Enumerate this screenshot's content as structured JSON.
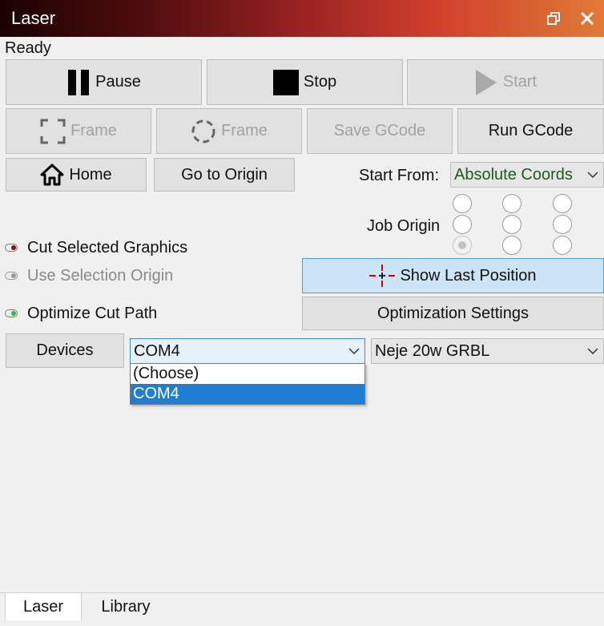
{
  "window": {
    "title": "Laser"
  },
  "status": "Ready",
  "controls": {
    "pause": "Pause",
    "stop": "Stop",
    "start": "Start",
    "frame_rect": "Frame",
    "frame_circle": "Frame",
    "save_gcode": "Save GCode",
    "run_gcode": "Run GCode",
    "home": "Home",
    "go_to_origin": "Go to Origin"
  },
  "start_from": {
    "label": "Start From:",
    "value": "Absolute Coords"
  },
  "job_origin": {
    "label": "Job Origin",
    "selected_index": 6
  },
  "options": {
    "cut_selected": {
      "label": "Cut Selected Graphics",
      "enabled": true
    },
    "use_selection_origin": {
      "label": "Use Selection Origin",
      "enabled": false
    },
    "optimize_cut_path": {
      "label": "Optimize Cut Path",
      "enabled": true
    }
  },
  "show_last_position": "Show Last Position",
  "optimization_settings": "Optimization Settings",
  "devices": {
    "button": "Devices",
    "port": "COM4",
    "port_options": [
      "(Choose)",
      "COM4"
    ],
    "profile": "Neje 20w GRBL"
  },
  "tabs": [
    "Laser",
    "Library"
  ],
  "colors": {
    "title_start": "#1b0202",
    "title_end": "#e07a36",
    "selected_option": "#1e7fd2",
    "toggle_on": "#2db84a",
    "toggle_red": "#7a1010"
  }
}
